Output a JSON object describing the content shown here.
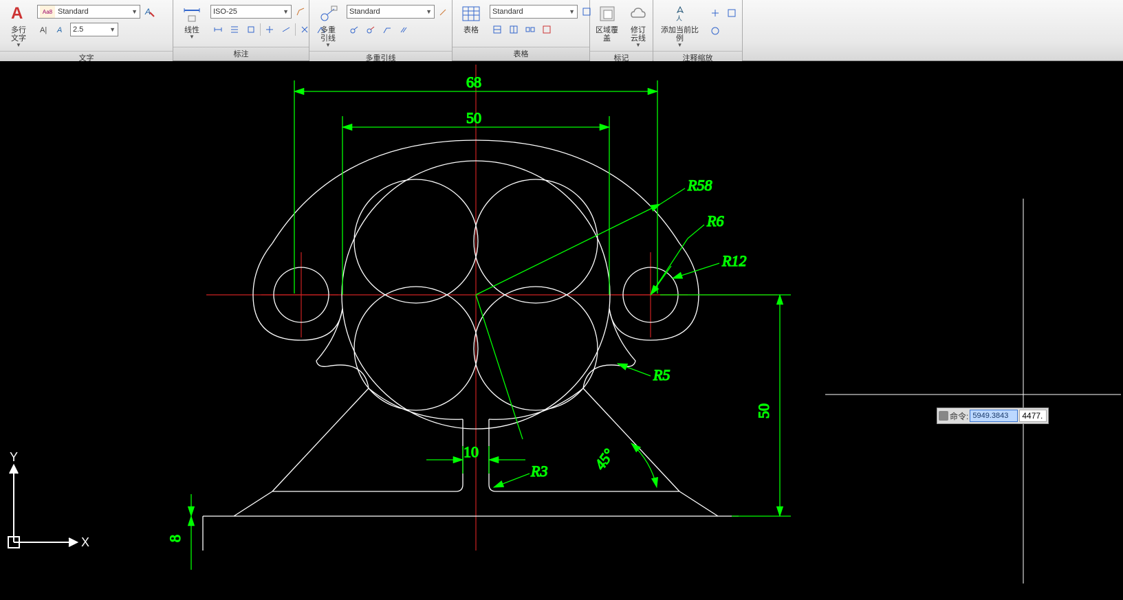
{
  "ribbon": {
    "panels": {
      "text": {
        "title": "文字",
        "big_btn": "多行\n文字",
        "style": "Standard",
        "height": "2.5"
      },
      "dim": {
        "title": "标注",
        "big_btn": "线性",
        "style": "ISO-25"
      },
      "mleader": {
        "title": "多重引线",
        "big_btn": "多重\n引线",
        "style": "Standard"
      },
      "table": {
        "title": "表格",
        "big_btn": "表格",
        "style": "Standard"
      },
      "markup": {
        "title": "标记",
        "btn1": "区域覆盖",
        "btn2": "修订\n云线"
      },
      "annoscale": {
        "title": "注释缩放",
        "big_btn": "添加当前比例"
      }
    }
  },
  "drawing": {
    "dims": {
      "d68": "68",
      "d50": "50",
      "d10": "10",
      "v50": "50",
      "v8": "8",
      "a45": "45°",
      "r58": "R58",
      "r6": "R6",
      "r12": "R12",
      "r5": "R5",
      "r3": "R3"
    },
    "ucs": {
      "x": "X",
      "y": "Y"
    }
  },
  "cmd": {
    "label": "命令:",
    "val1": "5949.3843",
    "val2": "4477."
  },
  "chart_data": {
    "type": "cad-drawing",
    "title": "2D CAD mechanical part — bracket with four inner circles",
    "linear_dimensions": [
      {
        "label": "68",
        "desc": "overall top width between ext lines"
      },
      {
        "label": "50",
        "desc": "inner top width between ext lines"
      },
      {
        "label": "10",
        "desc": "slot width at bottom neck"
      },
      {
        "label": "50",
        "desc": "vertical height from centerline to base (right side)"
      },
      {
        "label": "8",
        "desc": "base thickness (lower-left vertical)"
      }
    ],
    "radius_dimensions": [
      {
        "label": "R58",
        "desc": "large outer arc radius"
      },
      {
        "label": "R12",
        "desc": "right side boss outer circle radius"
      },
      {
        "label": "R6",
        "desc": "right side boss inner circle radius"
      },
      {
        "label": "R5",
        "desc": "fillet between body and right lug"
      },
      {
        "label": "R3",
        "desc": "fillet at bottom slot corner"
      }
    ],
    "angular_dimensions": [
      {
        "label": "45°",
        "desc": "chamfer / slant angle of base leg"
      }
    ],
    "colors": {
      "geometry": "#ffffff",
      "dimensions": "#00ff00",
      "centerlines": "#cc2222",
      "background": "#000000"
    }
  }
}
